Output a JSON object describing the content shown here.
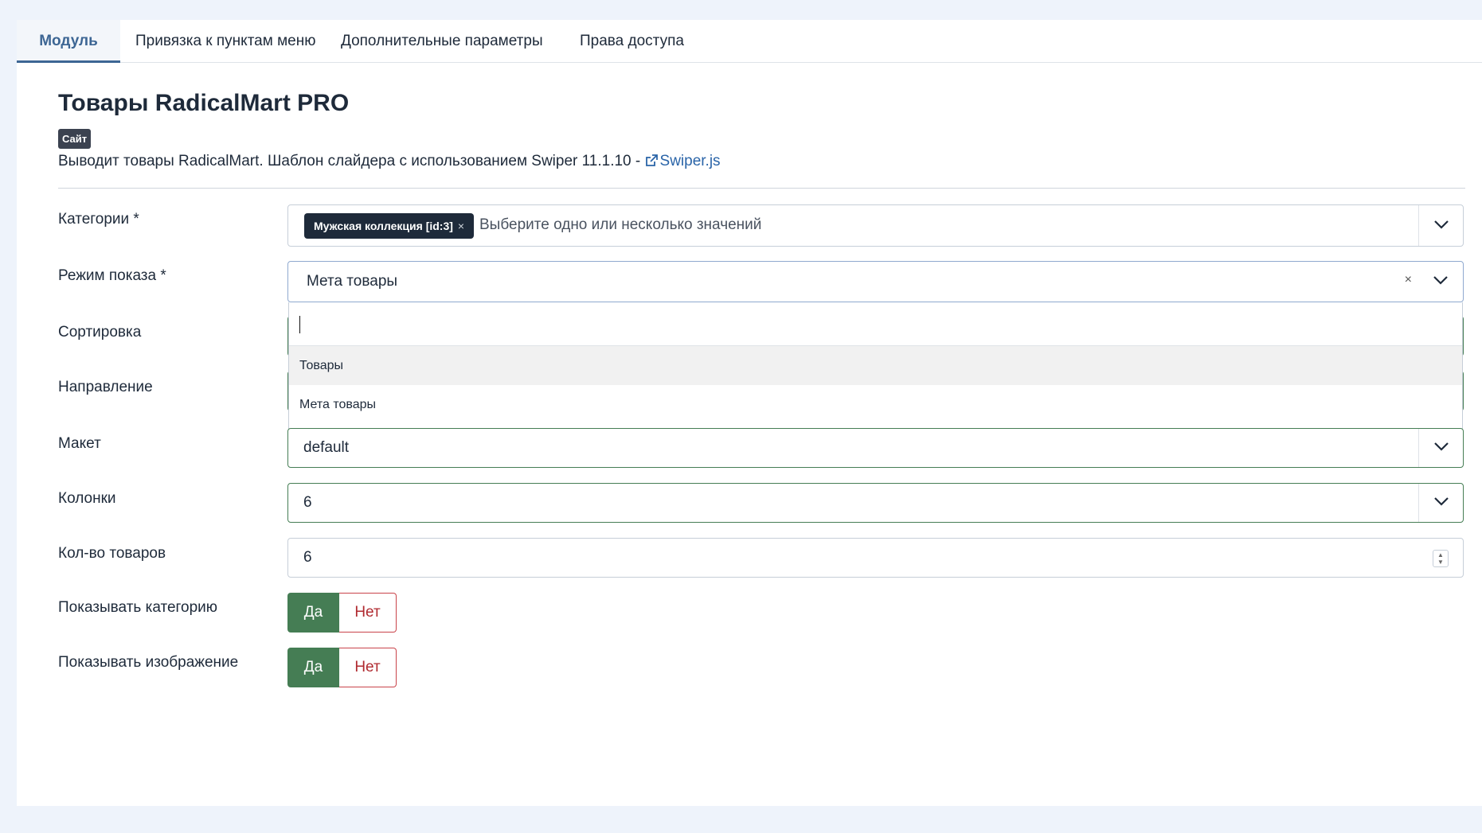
{
  "tabs": [
    {
      "label": "Модуль",
      "active": true
    },
    {
      "label": "Привязка к пунктам меню",
      "active": false
    },
    {
      "label": "Дополнительные параметры",
      "active": false
    },
    {
      "label": "Права доступа",
      "active": false
    }
  ],
  "module": {
    "title": "Товары RadicalMart PRO",
    "badge": "Сайт",
    "description": "Выводит товары RadicalMart. Шаблон слайдера с использованием Swiper 11.1.10 - ",
    "link_text": "Swiper.js"
  },
  "fields": {
    "categories": {
      "label": "Категории *",
      "chip": "Мужская коллекция [id:3]",
      "chip_remove": "×",
      "placeholder": "Выберите одно или несколько значений"
    },
    "mode": {
      "label": "Режим показа *",
      "value": "Мета товары",
      "clear": "×",
      "options": [
        "Товары",
        "Мета товары"
      ]
    },
    "sort": {
      "label": "Сортировка"
    },
    "direction": {
      "label": "Направление"
    },
    "layout": {
      "label": "Макет",
      "value": "default"
    },
    "columns": {
      "label": "Колонки",
      "value": "6"
    },
    "count": {
      "label": "Кол-во товаров",
      "value": "6"
    },
    "show_category": {
      "label": "Показывать категорию",
      "yes": "Да",
      "no": "Нет",
      "selected": "yes"
    },
    "show_image": {
      "label": "Показывать изображение",
      "yes": "Да",
      "no": "Нет",
      "selected": "yes"
    }
  },
  "colors": {
    "accent": "#3d6694",
    "success": "#457d54",
    "danger": "#b02a30",
    "chip": "#1e2a3a"
  }
}
